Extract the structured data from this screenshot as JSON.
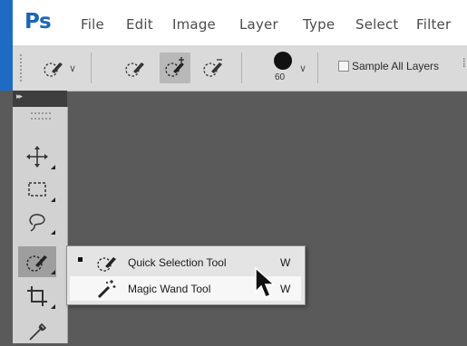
{
  "app": {
    "logo": "Ps",
    "menu": [
      "File",
      "Edit",
      "Image",
      "Layer",
      "Type",
      "Select",
      "Filter"
    ]
  },
  "options_bar": {
    "brush_size": "60",
    "sample_all_layers_label": "Sample All Layers",
    "sample_all_layers_checked": false
  },
  "toolbar": {
    "tools": [
      {
        "name": "move-tool",
        "icon": "move-icon"
      },
      {
        "name": "rectangular-marquee-tool",
        "icon": "marquee-icon"
      },
      {
        "name": "lasso-tool",
        "icon": "lasso-icon"
      },
      {
        "name": "quick-selection-tool",
        "icon": "quick-selection-icon",
        "active": true
      },
      {
        "name": "crop-tool",
        "icon": "crop-icon"
      },
      {
        "name": "eyedropper-tool",
        "icon": "eyedropper-icon"
      }
    ]
  },
  "flyout": {
    "items": [
      {
        "label": "Quick Selection Tool",
        "shortcut": "W",
        "current": true,
        "icon": "quick-selection-icon"
      },
      {
        "label": "Magic Wand Tool",
        "shortcut": "W",
        "current": false,
        "icon": "magic-wand-icon"
      }
    ]
  },
  "colors": {
    "accent": "#1f6bc4",
    "canvas": "#5a5a5a",
    "toolbar": "#d2d2d2"
  }
}
